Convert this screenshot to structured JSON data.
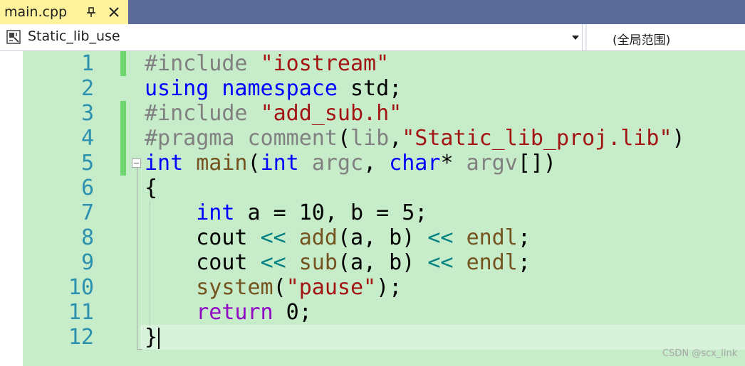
{
  "tab": {
    "title": "main.cpp"
  },
  "nav": {
    "project": "Static_lib_use",
    "scope": "(全局范围)"
  },
  "editor": {
    "line_numbers": [
      "1",
      "2",
      "3",
      "4",
      "5",
      "6",
      "7",
      "8",
      "9",
      "10",
      "11",
      "12"
    ],
    "lines": [
      [
        {
          "t": "#include ",
          "c": "pp"
        },
        {
          "t": "\"iostream\"",
          "c": "str"
        }
      ],
      [
        {
          "t": "using",
          "c": "kw"
        },
        {
          "t": " ",
          "c": "nm"
        },
        {
          "t": "namespace",
          "c": "kw"
        },
        {
          "t": " std;",
          "c": "nm"
        }
      ],
      [
        {
          "t": "#include ",
          "c": "pp"
        },
        {
          "t": "\"add_sub.h\"",
          "c": "str"
        }
      ],
      [
        {
          "t": "#pragma comment",
          "c": "pp"
        },
        {
          "t": "(",
          "c": "nm"
        },
        {
          "t": "lib",
          "c": "pp"
        },
        {
          "t": ",",
          "c": "nm"
        },
        {
          "t": "\"Static_lib_proj.lib\"",
          "c": "str"
        },
        {
          "t": ")",
          "c": "nm"
        }
      ],
      [
        {
          "t": "int",
          "c": "kw"
        },
        {
          "t": " ",
          "c": "nm"
        },
        {
          "t": "main",
          "c": "fn"
        },
        {
          "t": "(",
          "c": "nm"
        },
        {
          "t": "int",
          "c": "kw"
        },
        {
          "t": " ",
          "c": "nm"
        },
        {
          "t": "argc",
          "c": "par"
        },
        {
          "t": ", ",
          "c": "nm"
        },
        {
          "t": "char",
          "c": "kw"
        },
        {
          "t": "* ",
          "c": "nm"
        },
        {
          "t": "argv",
          "c": "par"
        },
        {
          "t": "[])",
          "c": "nm"
        }
      ],
      [
        {
          "t": "{",
          "c": "nm"
        }
      ],
      [
        {
          "t": "    ",
          "c": "nm"
        },
        {
          "t": "int",
          "c": "kw"
        },
        {
          "t": " a = 10, b = 5;",
          "c": "nm"
        }
      ],
      [
        {
          "t": "    cout ",
          "c": "nm"
        },
        {
          "t": "<<",
          "c": "op"
        },
        {
          "t": " ",
          "c": "nm"
        },
        {
          "t": "add",
          "c": "fn"
        },
        {
          "t": "(a, b) ",
          "c": "nm"
        },
        {
          "t": "<<",
          "c": "op"
        },
        {
          "t": " ",
          "c": "nm"
        },
        {
          "t": "endl",
          "c": "fn"
        },
        {
          "t": ";",
          "c": "nm"
        }
      ],
      [
        {
          "t": "    cout ",
          "c": "nm"
        },
        {
          "t": "<<",
          "c": "op"
        },
        {
          "t": " ",
          "c": "nm"
        },
        {
          "t": "sub",
          "c": "fn"
        },
        {
          "t": "(a, b) ",
          "c": "nm"
        },
        {
          "t": "<<",
          "c": "op"
        },
        {
          "t": " ",
          "c": "nm"
        },
        {
          "t": "endl",
          "c": "fn"
        },
        {
          "t": ";",
          "c": "nm"
        }
      ],
      [
        {
          "t": "    ",
          "c": "nm"
        },
        {
          "t": "system",
          "c": "fn"
        },
        {
          "t": "(",
          "c": "nm"
        },
        {
          "t": "\"pause\"",
          "c": "str"
        },
        {
          "t": ");",
          "c": "nm"
        }
      ],
      [
        {
          "t": "    ",
          "c": "nm"
        },
        {
          "t": "return",
          "c": "ctl"
        },
        {
          "t": " 0;",
          "c": "nm"
        }
      ],
      [
        {
          "t": "}",
          "c": "nm"
        }
      ]
    ],
    "changed_lines": [
      1,
      3,
      4,
      5
    ],
    "current_line": 12
  },
  "watermark": "CSDN @scx_link",
  "icons": {
    "pin": "pin-icon",
    "close": "close-icon",
    "project": "project-icon",
    "dropdown": "dropdown-icon",
    "fold": "collapse-icon"
  },
  "colors": {
    "tab_active": "#fff29d",
    "tab_bar": "#5d6b99",
    "editor_bg": "#c7ecca",
    "line_number": "#2b91af",
    "change_bar": "#6ed66e"
  }
}
